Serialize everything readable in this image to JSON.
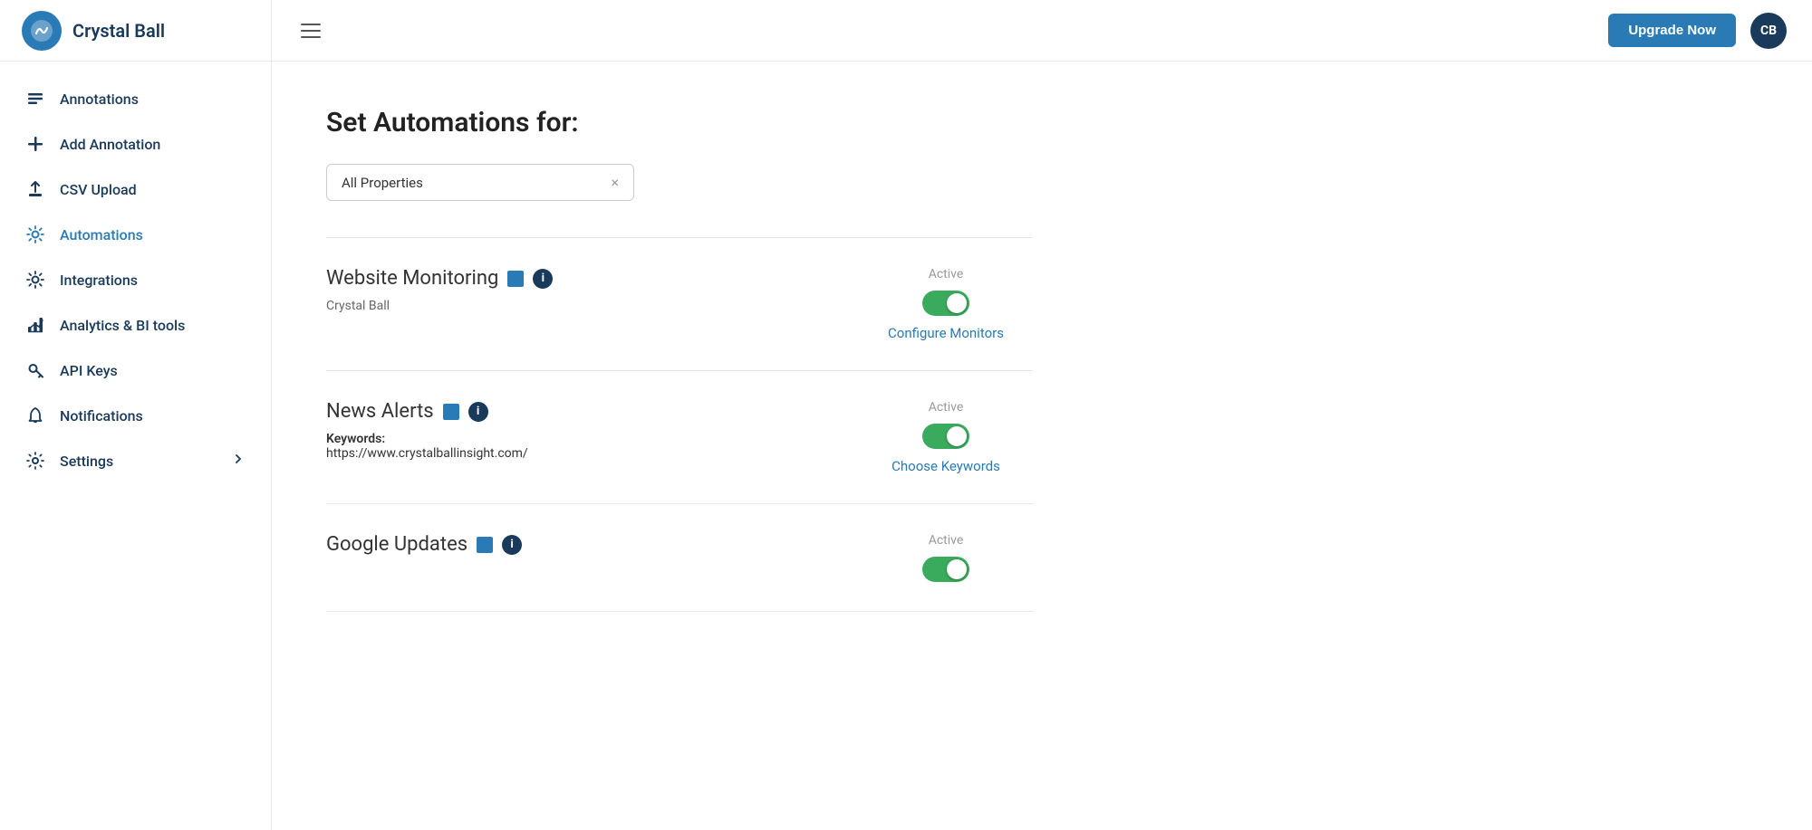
{
  "app": {
    "title": "Crystal Ball",
    "avatar_initials": "CB"
  },
  "topbar": {
    "upgrade_label": "Upgrade Now",
    "hamburger_label": "Menu"
  },
  "sidebar": {
    "items": [
      {
        "id": "annotations",
        "label": "Annotations",
        "icon": "list-icon"
      },
      {
        "id": "add-annotation",
        "label": "Add Annotation",
        "icon": "plus-icon"
      },
      {
        "id": "csv-upload",
        "label": "CSV Upload",
        "icon": "upload-icon"
      },
      {
        "id": "automations",
        "label": "Automations",
        "icon": "gear-sparkle-icon",
        "active": true
      },
      {
        "id": "integrations",
        "label": "Integrations",
        "icon": "gear-icon"
      },
      {
        "id": "analytics-bi",
        "label": "Analytics & BI tools",
        "icon": "chart-icon"
      },
      {
        "id": "api-keys",
        "label": "API Keys",
        "icon": "search-icon"
      },
      {
        "id": "notifications",
        "label": "Notifications",
        "icon": "bell-icon"
      },
      {
        "id": "settings",
        "label": "Settings",
        "icon": "settings-icon",
        "has_chevron": true
      }
    ]
  },
  "page": {
    "title": "Set Automations for:",
    "property_selector": {
      "value": "All Properties",
      "clear_icon": "×"
    }
  },
  "automations": [
    {
      "id": "website-monitoring",
      "title": "Website Monitoring",
      "subtitle": "Crystal Ball",
      "active": true,
      "link_label": "Configure Monitors",
      "color": "#2a7ab5"
    },
    {
      "id": "news-alerts",
      "title": "News Alerts",
      "keywords_label": "Keywords:",
      "keywords_value": "https://www.crystalballinsight.com/",
      "active": true,
      "link_label": "Choose Keywords",
      "color": "#2a7ab5"
    },
    {
      "id": "google-updates",
      "title": "Google Updates",
      "active": true,
      "link_label": "",
      "color": "#2a7ab5",
      "partial": true
    }
  ]
}
